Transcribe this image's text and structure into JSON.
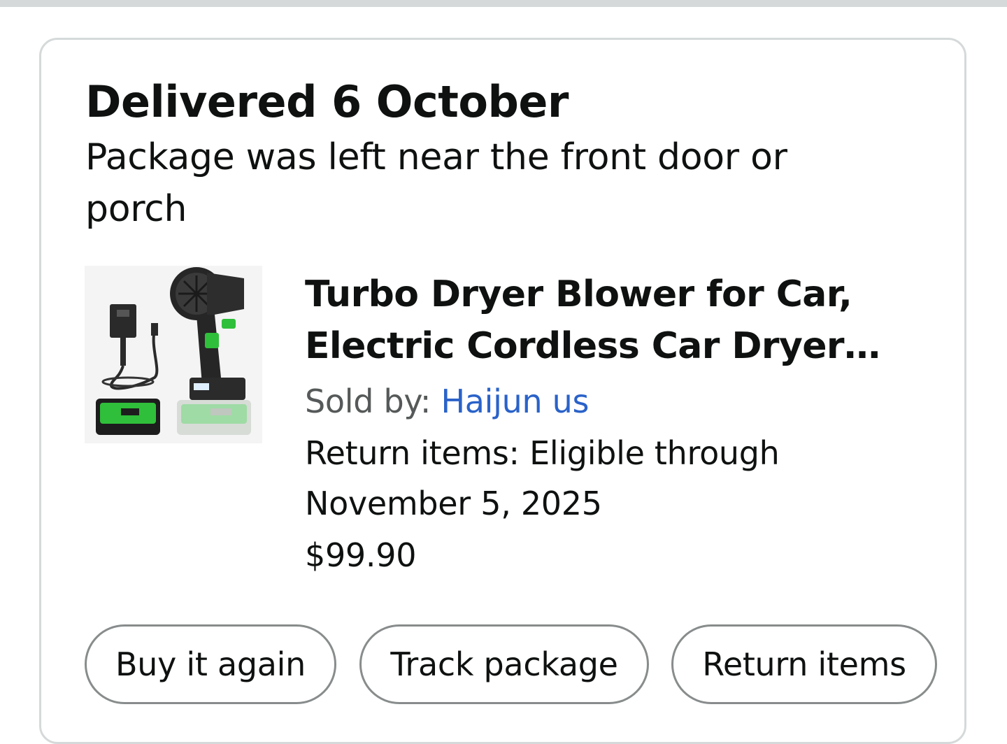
{
  "order": {
    "status_title": "Delivered 6 October",
    "status_detail": "Package was left near the front door or porch"
  },
  "product": {
    "title": "Turbo Dryer Blower for Car, Electric Cordless Car Dryer wi...",
    "sold_by_label": "Sold by: ",
    "seller_name": "Haijun us",
    "return_text": "Return items: Eligible through November 5, 2025",
    "price": "$99.90",
    "image_icon": "car-dryer-blower-product-image"
  },
  "actions": {
    "buy_again": "Buy it again",
    "track_package": "Track package",
    "return_items": "Return items"
  },
  "colors": {
    "link": "#2a62c9",
    "accent_green": "#22c55e",
    "border": "#d5d9d9"
  }
}
